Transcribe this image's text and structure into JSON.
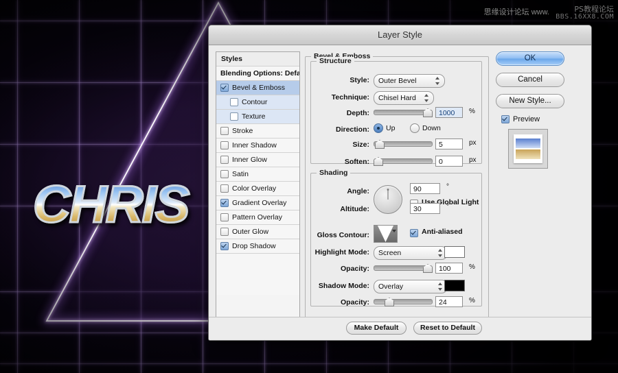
{
  "artwork": {
    "headline": "CHRIS",
    "watermark_cn_left": "思缘设计论坛  www.",
    "watermark_cn_right": "PS教程论坛",
    "watermark_url": "BBS.16XX8.COM",
    "neon_color": "#b48ce6",
    "background_color": "#050208"
  },
  "dialog": {
    "title": "Layer Style"
  },
  "sidebar": {
    "header": "Styles",
    "blending_options": "Blending Options: Default",
    "items": [
      {
        "label": "Bevel & Emboss",
        "checked": true,
        "kind": "sel"
      },
      {
        "label": "Contour",
        "checked": false,
        "kind": "sub"
      },
      {
        "label": "Texture",
        "checked": false,
        "kind": "sub"
      },
      {
        "label": "Stroke",
        "checked": false,
        "kind": "item"
      },
      {
        "label": "Inner Shadow",
        "checked": false,
        "kind": "item"
      },
      {
        "label": "Inner Glow",
        "checked": false,
        "kind": "item"
      },
      {
        "label": "Satin",
        "checked": false,
        "kind": "item"
      },
      {
        "label": "Color Overlay",
        "checked": false,
        "kind": "item"
      },
      {
        "label": "Gradient Overlay",
        "checked": true,
        "kind": "item"
      },
      {
        "label": "Pattern Overlay",
        "checked": false,
        "kind": "item"
      },
      {
        "label": "Outer Glow",
        "checked": false,
        "kind": "item"
      },
      {
        "label": "Drop Shadow",
        "checked": true,
        "kind": "item"
      }
    ]
  },
  "panel": {
    "group_title": "Bevel & Emboss",
    "structure": {
      "legend": "Structure",
      "style_label": "Style:",
      "style_value": "Outer Bevel",
      "technique_label": "Technique:",
      "technique_value": "Chisel Hard",
      "depth_label": "Depth:",
      "depth_value": "1000",
      "depth_unit": "%",
      "depth_percent": 100,
      "direction_label": "Direction:",
      "direction_up": "Up",
      "direction_down": "Down",
      "direction_selected": "Up",
      "size_label": "Size:",
      "size_value": "5",
      "size_unit": "px",
      "size_percent": 4,
      "soften_label": "Soften:",
      "soften_value": "0",
      "soften_unit": "px",
      "soften_percent": 0
    },
    "shading": {
      "legend": "Shading",
      "angle_label": "Angle:",
      "angle_value": "90",
      "angle_unit": "°",
      "global_light_label": "Use Global Light",
      "global_light_checked": false,
      "altitude_label": "Altitude:",
      "altitude_value": "30",
      "altitude_unit": "°",
      "gloss_contour_label": "Gloss Contour:",
      "antialiased_label": "Anti-aliased",
      "antialiased_checked": true,
      "highlight_mode_label": "Highlight Mode:",
      "highlight_mode_value": "Screen",
      "highlight_color": "#ffffff",
      "highlight_opacity_label": "Opacity:",
      "highlight_opacity_value": "100",
      "highlight_opacity_unit": "%",
      "highlight_opacity_percent": 100,
      "shadow_mode_label": "Shadow Mode:",
      "shadow_mode_value": "Overlay",
      "shadow_color": "#000000",
      "shadow_opacity_label": "Opacity:",
      "shadow_opacity_value": "24",
      "shadow_opacity_unit": "%",
      "shadow_opacity_percent": 24
    }
  },
  "buttons": {
    "ok": "OK",
    "cancel": "Cancel",
    "new_style": "New Style...",
    "preview": "Preview",
    "preview_checked": true,
    "make_default": "Make Default",
    "reset_to_default": "Reset to Default"
  }
}
